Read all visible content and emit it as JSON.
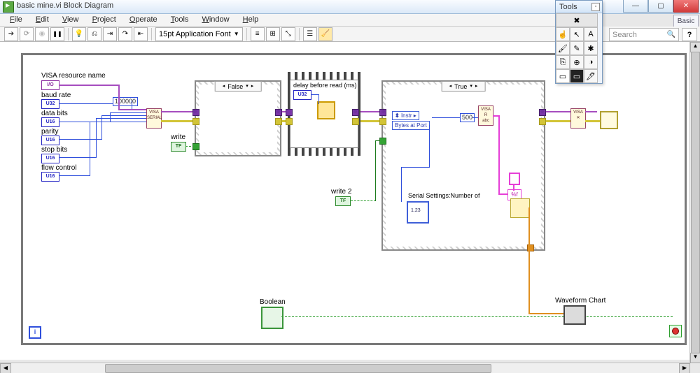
{
  "window": {
    "title": "basic mine.vi Block Diagram",
    "minimize": "—",
    "maximize": "▢",
    "close": "✕"
  },
  "menu": {
    "file": "File",
    "edit": "Edit",
    "view": "View",
    "project": "Project",
    "operate": "Operate",
    "tools": "Tools",
    "window": "Window",
    "help": "Help"
  },
  "toolbar": {
    "font": "15pt Application Font"
  },
  "search": {
    "placeholder": "Search"
  },
  "help_button": "?",
  "basic_tag": "Basic",
  "tools_palette": {
    "title": "Tools",
    "auto": "✖",
    "cells": [
      "☝",
      "↖",
      "A",
      "🖌",
      "✎",
      "✱",
      "⎘",
      "⊕",
      "◑"
    ],
    "colorrow": [
      "▭",
      "▭",
      "🖋"
    ]
  },
  "diagram": {
    "controls": {
      "visa_label": "VISA resource name",
      "visa_type": "I/O",
      "baud_label": "baud rate",
      "baud_type": "U32",
      "data_label": "data bits",
      "data_type": "U16",
      "parity_label": "parity",
      "parity_type": "U16",
      "stop_label": "stop bits",
      "stop_type": "U16",
      "flow_label": "flow control",
      "flow_type": "U16"
    },
    "baud_constant": "100000",
    "write_label": "write",
    "write_tf": "TF",
    "write2_label": "write 2",
    "write2_tf": "TF",
    "case_false": "False",
    "case_true": "True",
    "seq_label": "delay before read (ms)",
    "seq_type": "U32",
    "bytes_at_port": "Bytes at Port",
    "instr_label": "Instr",
    "read_bytes_const": "500",
    "serial_settings_label": "Serial Settings:Number of",
    "fmt_string": "%f",
    "boolean_label": "Boolean",
    "waveform_label": "Waveform Chart",
    "loop_i": "i"
  }
}
